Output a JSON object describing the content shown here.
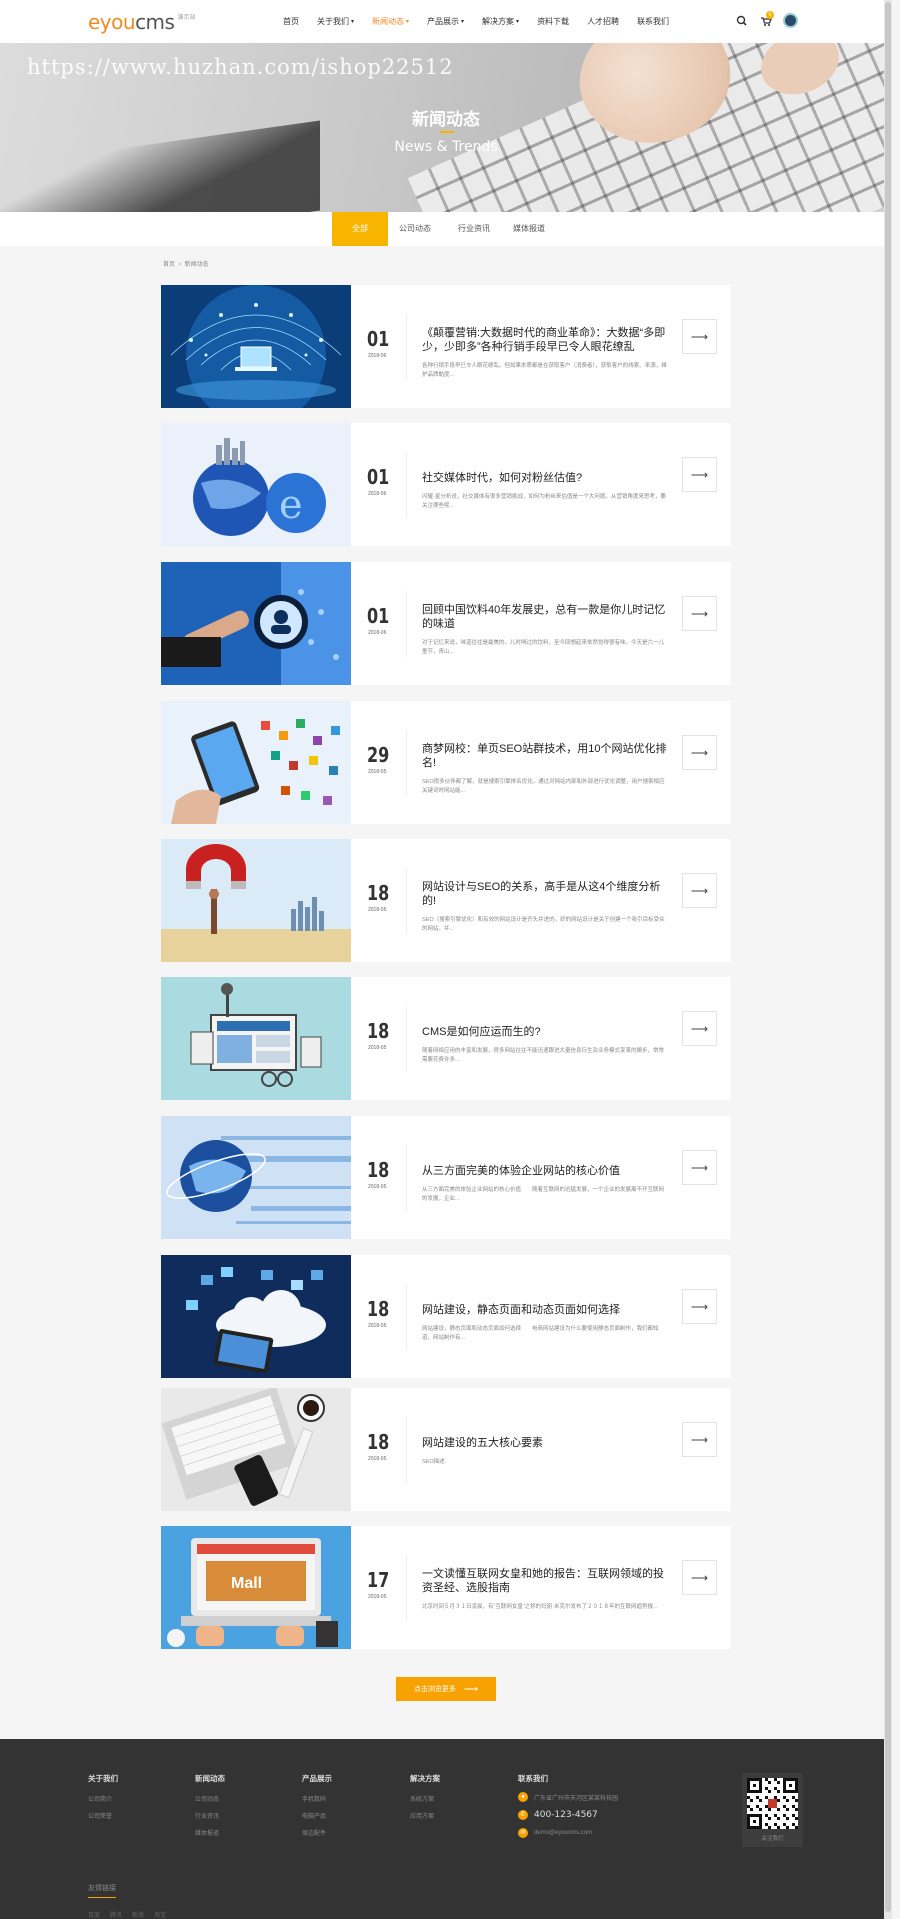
{
  "header": {
    "logo_main": "eyou",
    "logo_accent": "cms",
    "logo_sub": "演示站",
    "nav": [
      {
        "label": "首页",
        "caret": ""
      },
      {
        "label": "关于我们",
        "caret": "▾"
      },
      {
        "label": "新闻动态",
        "caret": "▾"
      },
      {
        "label": "产品展示",
        "caret": "▾"
      },
      {
        "label": "解决方案",
        "caret": "▾"
      },
      {
        "label": "资料下载",
        "caret": ""
      },
      {
        "label": "人才招聘",
        "caret": ""
      },
      {
        "label": "联系我们",
        "caret": ""
      }
    ],
    "active_nav": 2,
    "cart_count": "0"
  },
  "banner": {
    "watermark": "https://www.huzhan.com/ishop22512",
    "title": "新闻动态",
    "subtitle": "News & Trends"
  },
  "tabs": [
    "全部",
    "公司动态",
    "行业资讯",
    "媒体报道"
  ],
  "breadcrumb": {
    "home": "首页",
    "sep": ">",
    "current": "新闻动态"
  },
  "articles": [
    {
      "day": "01",
      "ym": "2018-06",
      "title": "《颠覆营销:大数据时代的商业革命》：大数据“多即少，少即多”各种行销手段早已令人眼花缭乱",
      "desc": "各种行销手段早已令人眼花缭乱。但如果本质都是在获取客户（消费者），获取客户的线索、来源，维护品牌黏度..."
    },
    {
      "day": "01",
      "ym": "2018-06",
      "title": "社交媒体时代，如何对粉丝估值?",
      "desc": "闪耀·星分析说，社交媒体有很多营销挑战，如何为粉丝来估值是一个大问题。从营销角度来思考，要关注哪些呢..."
    },
    {
      "day": "01",
      "ym": "2018-06",
      "title": "回顾中国饮料40年发展史，总有一款是你儿时记忆的味道",
      "desc": "对于记忆来说，味道往往是最美的。儿时喝过的饮料，至今回想起来依然觉得很有味。今天是六一儿童节，青山..."
    },
    {
      "day": "29",
      "ym": "2018-05",
      "title": "商梦网校：单页SEO站群技术，用10个网站优化排名!",
      "desc": "SEO很多伙伴都了解，就是搜索引擎排名优化。通过对网站内部和外部进行优化调整，用户搜索相应关键词时网站能..."
    },
    {
      "day": "18",
      "ym": "2018-05",
      "title": "网站设计与SEO的关系，高手是从这4个维度分析的!",
      "desc": "SEO（搜索引擎优化）和有效的网站设计是齐头并进的。好的网站设计是关于创建一个吸引目标受众的网站，并..."
    },
    {
      "day": "18",
      "ym": "2018-05",
      "title": "CMS是如何应运而生的?",
      "desc": "随着网络应用的丰富和发展，很多网站往往不能迅速跟进大量信息衍生及业务模式变革的脚步，常常需要花费许多..."
    },
    {
      "day": "18",
      "ym": "2018-05",
      "title": "从三方面完美的体验企业网站的核心价值",
      "desc": "从三方面完美的体验企业网站的核心价值　　随着互联网的迅猛发展，一个企业的发展离不开互联网的发展，企业..."
    },
    {
      "day": "18",
      "ym": "2018-05",
      "title": "网站建设，静态页面和动态页面如何选择",
      "desc": "网站建设，静态页面和动态页面如何选择　　电商网站建设为什么要使用静态页面制作，我们都知道，网站制作有..."
    },
    {
      "day": "18",
      "ym": "2018-05",
      "title": "网站建设的五大核心要素",
      "desc": "SEO描述"
    },
    {
      "day": "17",
      "ym": "2018-05",
      "title": "一文读懂互联网女皇和她的报告：互联网领域的投资圣经、选股指南",
      "desc": "北京时间５月３１日凌晨，有“互联网女皇”之称的玛丽·米克尔发布了２０１８年的互联网趋势报..."
    }
  ],
  "more_button": "点击浏览更多",
  "footer": {
    "cols": [
      {
        "title": "关于我们",
        "items": [
          "公司简介",
          "公司荣誉"
        ]
      },
      {
        "title": "新闻动态",
        "items": [
          "公司动态",
          "行业资讯",
          "媒体报道"
        ]
      },
      {
        "title": "产品展示",
        "items": [
          "手机数码",
          "电脑产品",
          "周边配件"
        ]
      },
      {
        "title": "解决方案",
        "items": [
          "系统方案",
          "应用方案"
        ]
      }
    ],
    "contact_title": "联系我们",
    "address": "广东省广州市天河区某某科技园",
    "phone": "400-123-4567",
    "email": "demo@eyoucms.com",
    "qr_caption": "关注我们",
    "friend_title": "友情链接",
    "friend_links": [
      "百度",
      "腾讯",
      "新浪",
      "淘宝"
    ]
  },
  "colors": {
    "accent": "#f7b500",
    "brand": "#f08a24",
    "footer_bg": "#333333"
  }
}
